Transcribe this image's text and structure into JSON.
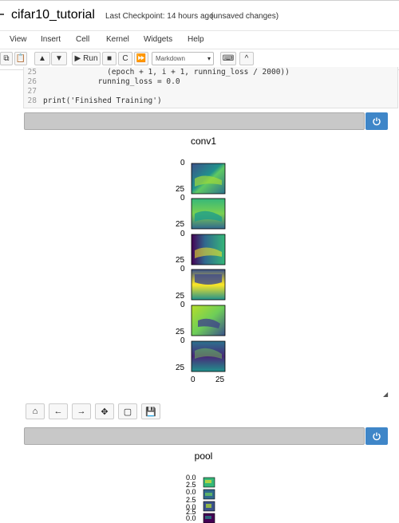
{
  "header": {
    "notebook_title": "cifar10_tutorial",
    "checkpoint": "Last Checkpoint: 14 hours ago",
    "status": "(unsaved changes)"
  },
  "menu": [
    "View",
    "Insert",
    "Cell",
    "Kernel",
    "Widgets",
    "Help"
  ],
  "toolbar": {
    "run_label": "Run",
    "cell_type": "Markdown"
  },
  "code": {
    "lines": [
      {
        "num": "25",
        "text": "              (epoch + 1, i + 1, running_loss / 2000))"
      },
      {
        "num": "26",
        "text": "            running_loss = 0.0"
      },
      {
        "num": "27",
        "text": ""
      },
      {
        "num": "28",
        "text": "print('Finished Training')"
      }
    ]
  },
  "figure1": {
    "title": "conv1",
    "y_ticks": [
      "0",
      "25",
      "0",
      "25",
      "0",
      "25",
      "0",
      "25",
      "0",
      "25",
      "0",
      "25"
    ],
    "x_ticks": [
      "0",
      "25"
    ]
  },
  "figure2": {
    "title": "pool",
    "tick_labels": [
      "0.0",
      "2.5",
      "0.0",
      "2.5",
      "0.0",
      "2.5",
      "0.0"
    ]
  },
  "colors": {
    "accent": "#3f86c8",
    "widget_bar": "#c8c8c8",
    "viridis_dark": "#440154",
    "viridis_mid": "#21918c",
    "viridis_light": "#fde725"
  }
}
